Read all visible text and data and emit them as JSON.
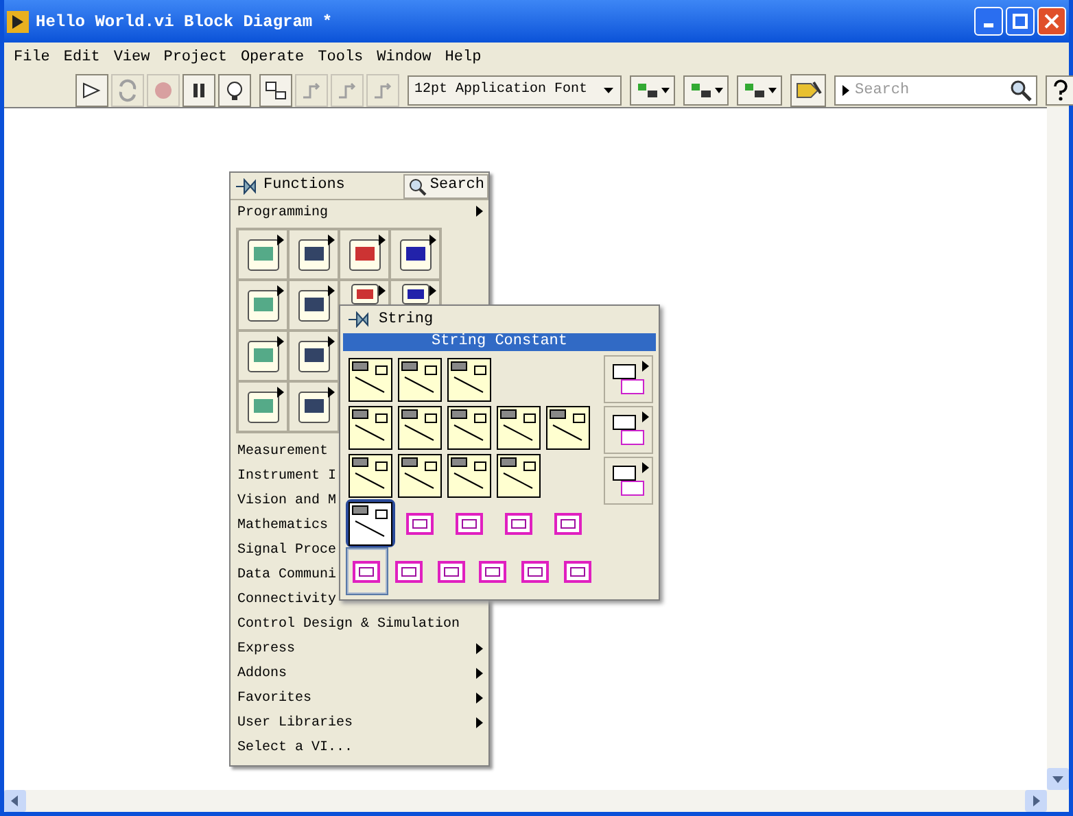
{
  "window": {
    "title": "Hello World.vi Block Diagram *"
  },
  "menu": [
    "File",
    "Edit",
    "View",
    "Project",
    "Operate",
    "Tools",
    "Window",
    "Help"
  ],
  "toolbar": {
    "font": "12pt Application Font",
    "search": {
      "placeholder": "Search"
    },
    "buttons": [
      {
        "kind": "run",
        "disabled": false
      },
      {
        "kind": "run-continuous",
        "disabled": true
      },
      {
        "kind": "abort",
        "disabled": true
      },
      {
        "kind": "pause",
        "disabled": false
      },
      {
        "kind": "highlight",
        "disabled": false
      },
      {
        "kind": "probe",
        "disabled": false
      },
      {
        "kind": "step-into",
        "disabled": true
      },
      {
        "kind": "step-over",
        "disabled": true
      },
      {
        "kind": "step-out",
        "disabled": true
      }
    ]
  },
  "functions_palette": {
    "title": "Functions",
    "search_label": "Search",
    "category": "Programming",
    "items": [
      {
        "label": "Measurement",
        "submenu": false
      },
      {
        "label": "Instrument I",
        "submenu": false
      },
      {
        "label": "Vision and M",
        "submenu": false
      },
      {
        "label": "Mathematics",
        "submenu": false
      },
      {
        "label": "Signal Proce",
        "submenu": false
      },
      {
        "label": "Data Communi",
        "submenu": false
      },
      {
        "label": "Connectivity",
        "submenu": false
      },
      {
        "label": "Control Design & Simulation",
        "submenu": false
      },
      {
        "label": "Express",
        "submenu": true
      },
      {
        "label": "Addons",
        "submenu": true
      },
      {
        "label": "Favorites",
        "submenu": true
      },
      {
        "label": "User Libraries",
        "submenu": true
      },
      {
        "label": "Select a VI...",
        "submenu": false
      }
    ]
  },
  "string_palette": {
    "title": "String",
    "hovered_name": "String Constant",
    "rows": [
      [
        {
          "kind": "vi",
          "selected": false,
          "hovered": false
        },
        {
          "kind": "vi",
          "selected": false,
          "hovered": false
        },
        {
          "kind": "vi",
          "selected": false,
          "hovered": false
        }
      ],
      [
        {
          "kind": "vi",
          "selected": false,
          "hovered": false
        },
        {
          "kind": "vi",
          "selected": false,
          "hovered": false
        },
        {
          "kind": "vi",
          "selected": false,
          "hovered": false
        },
        {
          "kind": "vi",
          "selected": false,
          "hovered": false
        },
        {
          "kind": "vi",
          "selected": false,
          "hovered": false
        }
      ],
      [
        {
          "kind": "vi",
          "selected": false,
          "hovered": false
        },
        {
          "kind": "vi",
          "selected": false,
          "hovered": false
        },
        {
          "kind": "vi",
          "selected": false,
          "hovered": false
        },
        {
          "kind": "vi",
          "selected": false,
          "hovered": false
        }
      ],
      [
        {
          "kind": "vi",
          "selected": true,
          "hovered": false
        },
        {
          "kind": "constant",
          "selected": false,
          "hovered": false
        },
        {
          "kind": "constant",
          "selected": false,
          "hovered": false
        },
        {
          "kind": "constant",
          "selected": false,
          "hovered": false
        },
        {
          "kind": "constant",
          "selected": false,
          "hovered": false
        }
      ],
      [
        {
          "kind": "constant",
          "selected": false,
          "hovered": true
        },
        {
          "kind": "constant",
          "selected": false,
          "hovered": false
        },
        {
          "kind": "constant",
          "selected": false,
          "hovered": false
        },
        {
          "kind": "constant",
          "selected": false,
          "hovered": false
        },
        {
          "kind": "constant",
          "selected": false,
          "hovered": false
        },
        {
          "kind": "constant",
          "selected": false,
          "hovered": false
        }
      ]
    ],
    "subpalettes": [
      {
        "submenu": true
      },
      {
        "submenu": true
      },
      {
        "submenu": true
      }
    ]
  }
}
